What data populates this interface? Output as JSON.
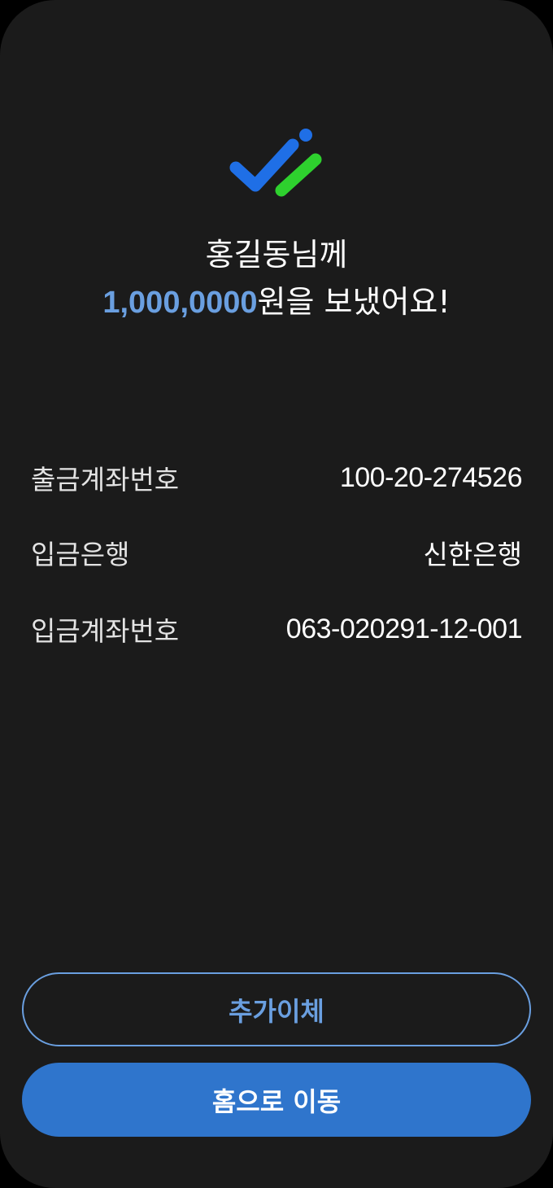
{
  "header": {
    "recipient_line": "홍길동님께",
    "amount": "1,000,0000",
    "amount_suffix": "원을 보냈어요!"
  },
  "details": [
    {
      "label": "출금계좌번호",
      "value": "100-20-274526"
    },
    {
      "label": "입금은행",
      "value": "신한은행"
    },
    {
      "label": "입금계좌번호",
      "value": "063-020291-12-001"
    }
  ],
  "actions": {
    "additional_transfer_label": "추가이체",
    "go_home_label": "홈으로 이동"
  },
  "colors": {
    "background": "#1b1b1b",
    "accent_blue": "#6a9fe0",
    "primary_button": "#2f75cc",
    "logo_blue": "#1f6fe6",
    "logo_green": "#2ed12e"
  },
  "icons": {
    "logo": "check-logo-icon"
  }
}
